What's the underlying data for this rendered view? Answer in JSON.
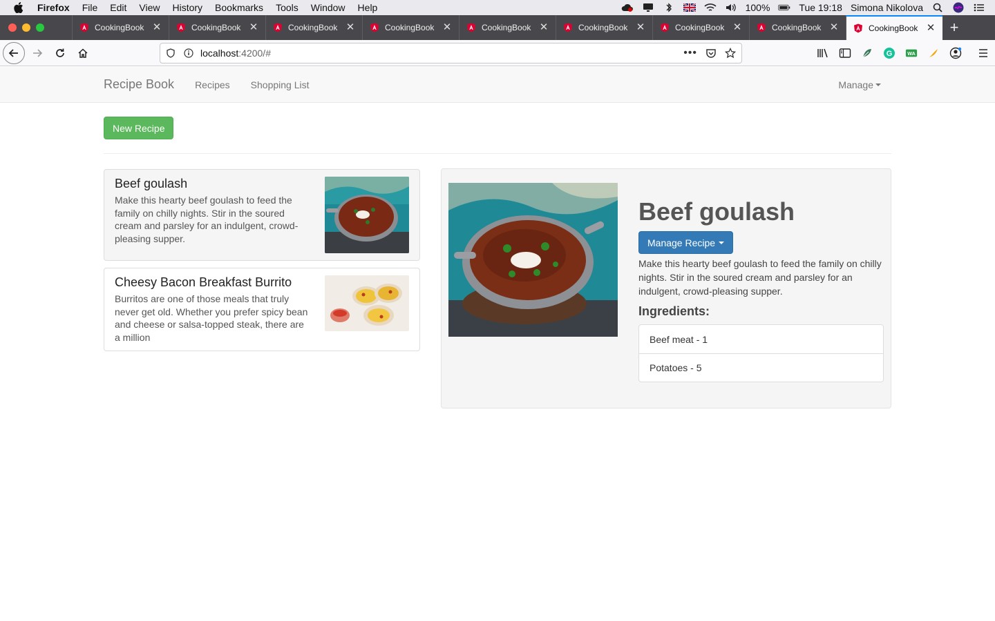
{
  "menubar": {
    "app_name": "Firefox",
    "items": [
      "File",
      "Edit",
      "View",
      "History",
      "Bookmarks",
      "Tools",
      "Window",
      "Help"
    ],
    "battery": "100%",
    "clock": "Tue 19:18",
    "user": "Simona Nikolova"
  },
  "tabs": [
    {
      "title": "CookingBook"
    },
    {
      "title": "CookingBook"
    },
    {
      "title": "CookingBook"
    },
    {
      "title": "CookingBook"
    },
    {
      "title": "CookingBook"
    },
    {
      "title": "CookingBook"
    },
    {
      "title": "CookingBook"
    },
    {
      "title": "CookingBook"
    },
    {
      "title": "CookingBook",
      "active": true
    }
  ],
  "urlbar": {
    "host": "localhost",
    "rest": ":4200/#"
  },
  "app": {
    "brand": "Recipe Book",
    "nav": {
      "recipes": "Recipes",
      "shopping_list": "Shopping List",
      "manage": "Manage"
    },
    "new_recipe_label": "New Recipe",
    "recipes": [
      {
        "name": "Beef goulash",
        "description": "Make this hearty beef goulash to feed the family on chilly nights. Stir in the soured cream and parsley for an indulgent, crowd-pleasing supper."
      },
      {
        "name": "Cheesy Bacon Breakfast Burrito",
        "description": "Burritos are one of those meals that truly never get old. Whether you prefer spicy bean and cheese or salsa-topped steak, there are a million"
      }
    ],
    "detail": {
      "name": "Beef goulash",
      "manage_label": "Manage Recipe",
      "description": "Make this hearty beef goulash to feed the family on chilly nights. Stir in the soured cream and parsley for an indulgent, crowd-pleasing supper.",
      "ingredients_heading": "Ingredients:",
      "ingredients": [
        "Beef meat - 1",
        "Potatoes - 5"
      ]
    }
  },
  "colors": {
    "success": "#5cb85c",
    "primary": "#337ab7",
    "tab_accent": "#0a84ff",
    "angular_red": "#dd0031"
  }
}
